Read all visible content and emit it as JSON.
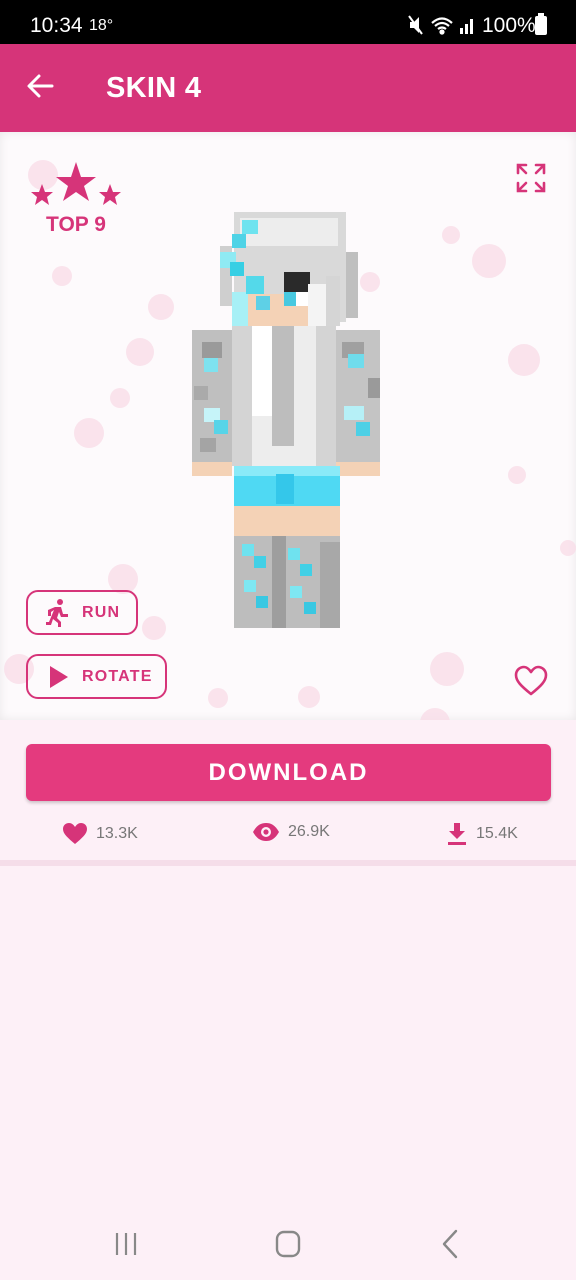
{
  "status_bar": {
    "time": "10:34",
    "temperature": "18°",
    "battery_percent": "100%"
  },
  "app_bar": {
    "title": "SKIN 4",
    "back_icon": "arrow-left-icon",
    "color": "#d63479"
  },
  "preview": {
    "rank_label": "TOP 9",
    "star_icon": "star-icon",
    "fullscreen_icon": "fullscreen-icon",
    "run_label": "RUN",
    "run_icon": "running-person-icon",
    "rotate_label": "ROTATE",
    "rotate_icon": "play-icon",
    "favorite_icon": "heart-outline-icon",
    "accent_color": "#d63479"
  },
  "download": {
    "label": "DOWNLOAD",
    "color": "#e43a7e"
  },
  "stats": {
    "likes": "13.3K",
    "views": "26.9K",
    "downloads": "15.4K",
    "likes_icon": "heart-icon",
    "views_icon": "eye-icon",
    "downloads_icon": "download-icon"
  },
  "nav_bar": {
    "recents_icon": "recents-icon",
    "home_icon": "home-icon",
    "back_icon": "back-chevron-icon"
  }
}
